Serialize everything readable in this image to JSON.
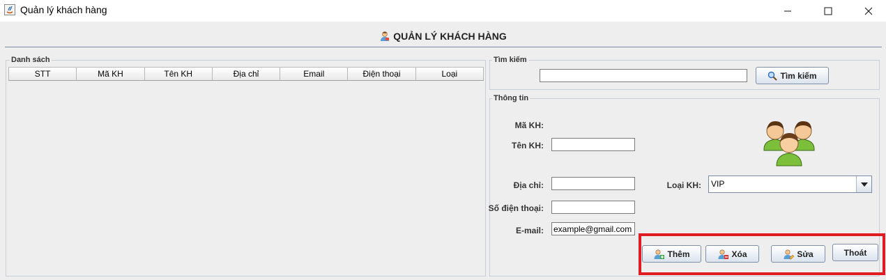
{
  "window": {
    "title": "Quản lý khách hàng"
  },
  "header": {
    "title": "QUẢN LÝ KHÁCH HÀNG"
  },
  "list": {
    "legend": "Danh sách",
    "columns": [
      "STT",
      "Mã KH",
      "Tên KH",
      "Địa chỉ",
      "Email",
      "Điện thoại",
      "Loại"
    ]
  },
  "search": {
    "legend": "Tìm kiếm",
    "value": "",
    "button_label": "Tìm kiếm"
  },
  "info": {
    "legend": "Thông tin",
    "ma_kh_label": "Mã KH:",
    "ten_kh_label": "Tên KH:",
    "ten_kh_value": "",
    "dia_chi_label": "Địa chỉ:",
    "dia_chi_value": "",
    "sdt_label": "Số điện thoại:",
    "sdt_value": "",
    "email_label": "E-mail:",
    "email_value": "example@gmail.com",
    "loai_kh_label": "Loại KH:",
    "loai_kh_value": "VIP"
  },
  "actions": {
    "add": "Thêm",
    "delete": "Xóa",
    "edit": "Sửa",
    "exit": "Thoát"
  },
  "colors": {
    "highlight": "#e11b22",
    "separator": "#7a8aa6"
  }
}
